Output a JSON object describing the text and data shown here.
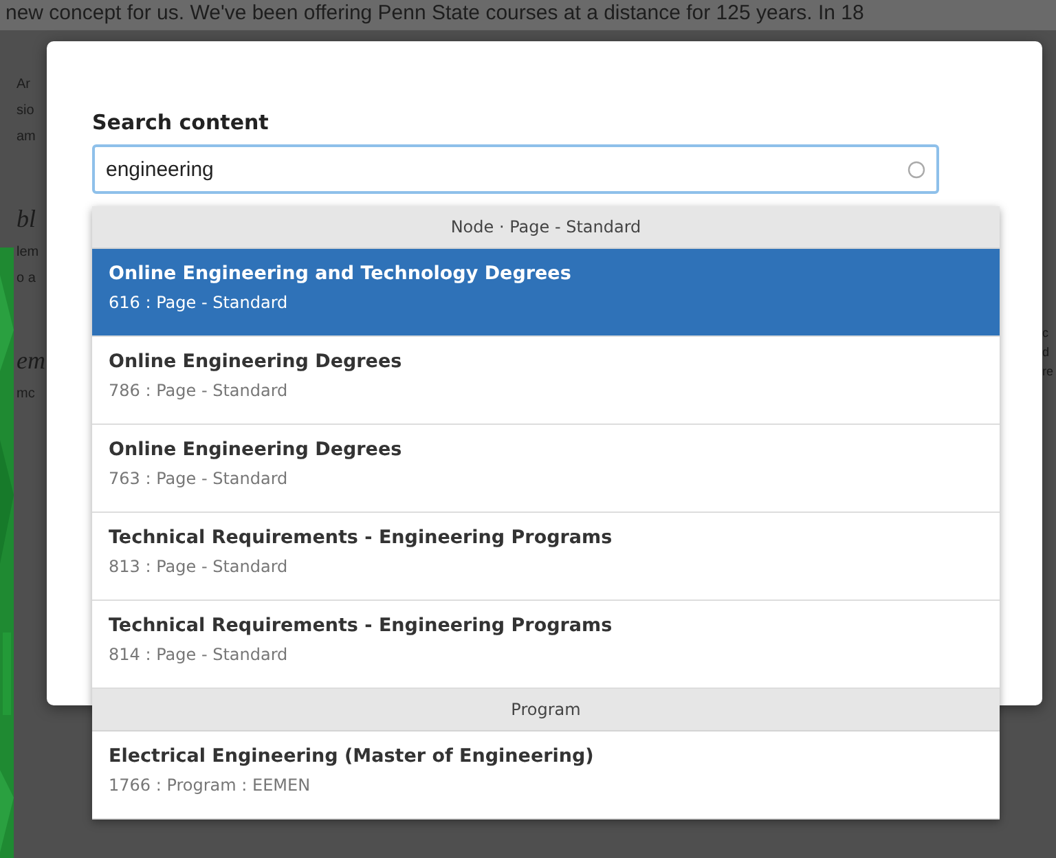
{
  "background": {
    "top_line": "new concept for us. We've been offering Penn State courses at a distance for 125 years. In 18",
    "left_fragments": [
      {
        "text": "Ar",
        "kind": "plain"
      },
      {
        "text": "sio",
        "kind": "plain"
      },
      {
        "text": "am",
        "kind": "plain"
      },
      {
        "text": "bl",
        "kind": "heading"
      },
      {
        "text": "lem",
        "kind": "plain"
      },
      {
        "text": "o a",
        "kind": "plain"
      },
      {
        "text": "em",
        "kind": "heading"
      },
      {
        "text": "mc",
        "kind": "plain"
      }
    ],
    "right_fragments": [
      "c",
      "d",
      "re"
    ]
  },
  "dialog": {
    "label": "Search content",
    "search": {
      "value": "engineering"
    }
  },
  "results": [
    {
      "kind": "group",
      "label": "Node · Page - Standard"
    },
    {
      "kind": "item",
      "title": "Online Engineering and Technology Degrees",
      "meta": "616 : Page - Standard",
      "selected": true
    },
    {
      "kind": "item",
      "title": "Online Engineering Degrees",
      "meta": "786 : Page - Standard",
      "selected": false
    },
    {
      "kind": "item",
      "title": "Online Engineering Degrees",
      "meta": "763 : Page - Standard",
      "selected": false
    },
    {
      "kind": "item",
      "title": "Technical Requirements - Engineering Programs",
      "meta": "813 : Page - Standard",
      "selected": false
    },
    {
      "kind": "item",
      "title": "Technical Requirements - Engineering Programs",
      "meta": "814 : Page - Standard",
      "selected": false
    },
    {
      "kind": "group",
      "label": "Program"
    },
    {
      "kind": "item",
      "title": "Electrical Engineering (Master of Engineering)",
      "meta": "1766 : Program : EEMEN",
      "selected": false
    }
  ]
}
